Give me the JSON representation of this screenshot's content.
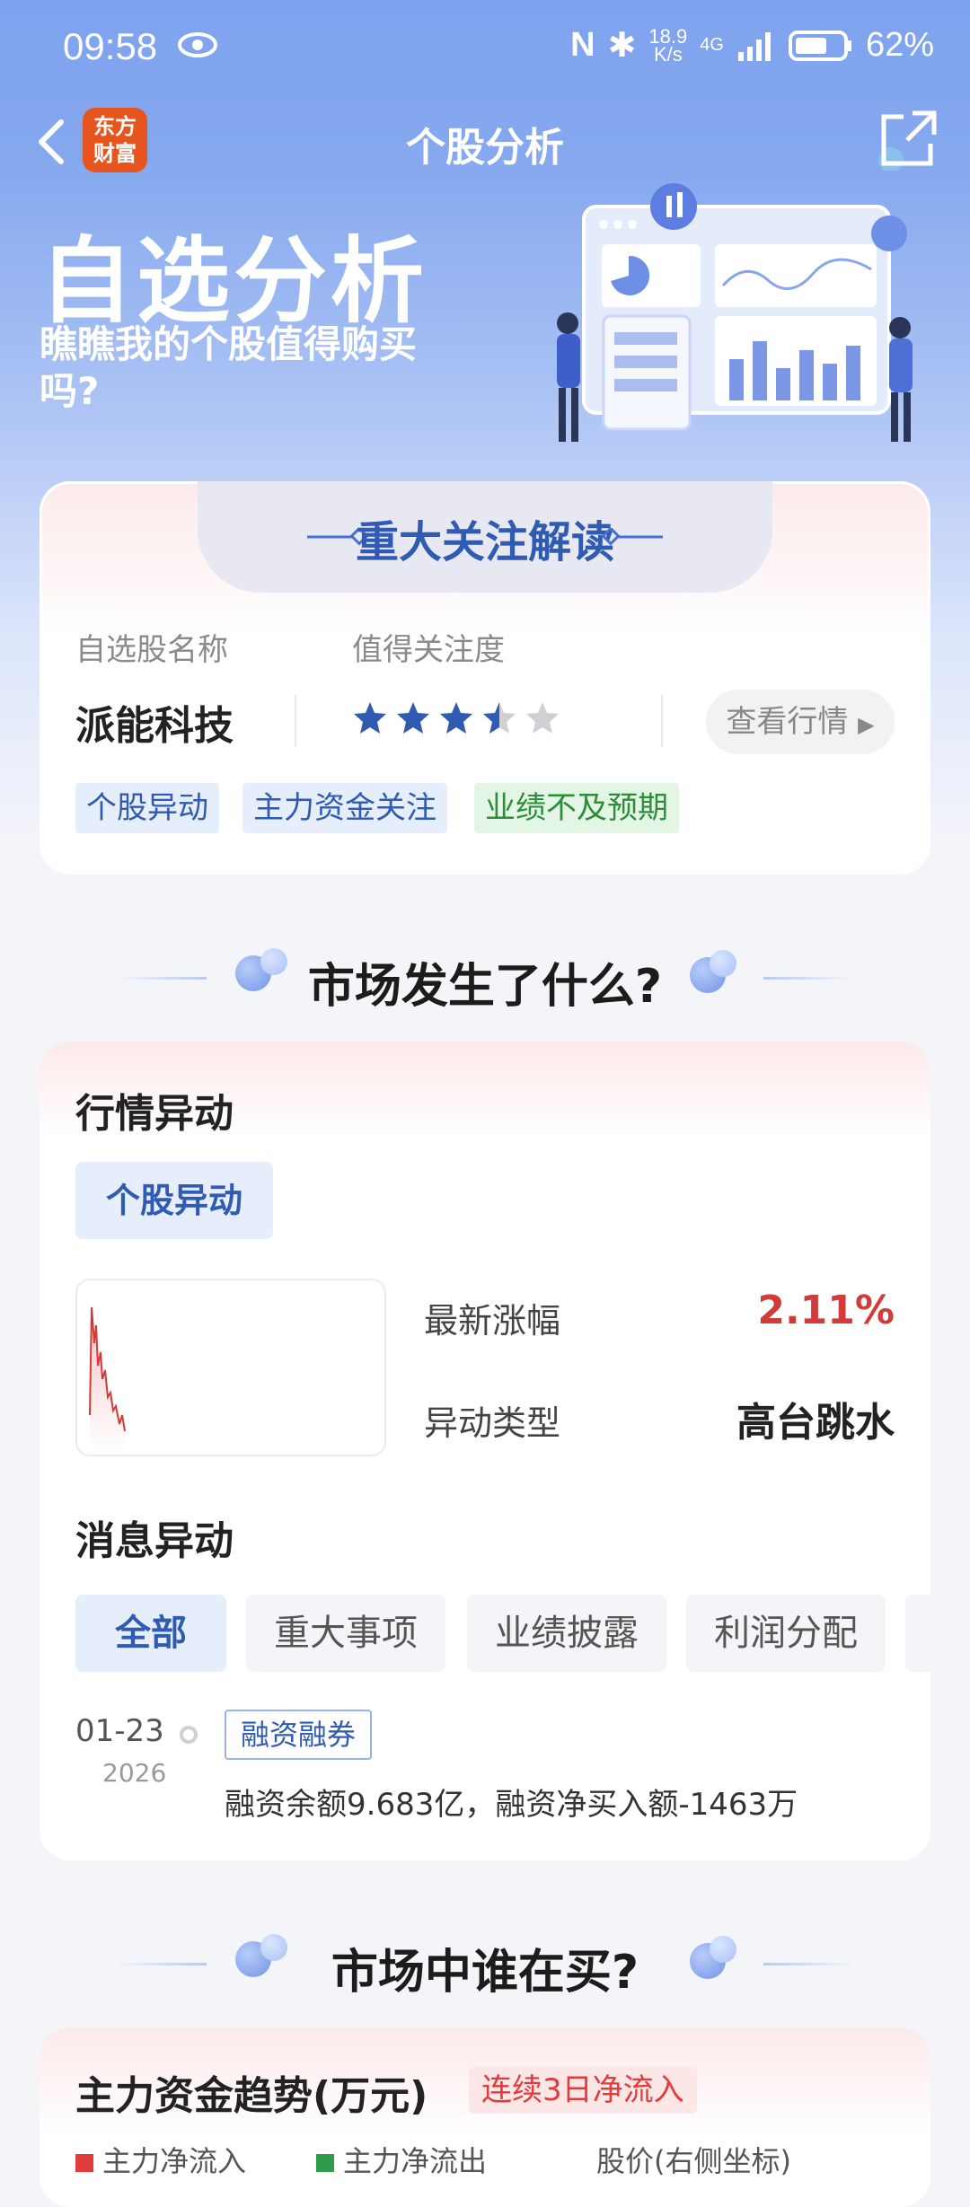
{
  "status": {
    "time": "09:58",
    "speed": "18.9\nK/s",
    "network": "4G",
    "battery": "62%"
  },
  "nav": {
    "logo": "东方\n财富",
    "title": "个股分析"
  },
  "hero": {
    "title": "自选分析",
    "subtitle": "瞧瞧我的个股值得购买吗?"
  },
  "focus_card": {
    "heading": "重大关注解读",
    "name_label": "自选股名称",
    "attention_label": "值得关注度",
    "stock_name": "派能科技",
    "rating": 3.5,
    "rating_max": 5,
    "view_button": "查看行情",
    "tags": [
      "个股异动",
      "主力资金关注",
      "业绩不及预期"
    ]
  },
  "section1": {
    "title": "市场发生了什么?"
  },
  "market_card": {
    "title": "行情异动",
    "pill": "个股异动",
    "latest_change_label": "最新涨幅",
    "latest_change_value": "2.11%",
    "type_label": "异动类型",
    "type_value": "高台跳水",
    "news_title": "消息异动",
    "filters": [
      "全部",
      "重大事项",
      "业绩披露",
      "利润分配"
    ],
    "news": {
      "date": "01-23",
      "year": "2026",
      "tag": "融资融券",
      "text": "融资余额9.683亿，融资净买入额-1463万"
    }
  },
  "section2": {
    "title": "市场中谁在买?"
  },
  "capital_card": {
    "title": "主力资金趋势(万元)",
    "badge": "连续3日净流入",
    "legend": [
      "主力净流入",
      "主力净流出",
      "股价(右侧坐标)"
    ]
  },
  "colors": {
    "brand_blue": "#2f5bb2",
    "up_red": "#d33a3a",
    "logo_orange": "#e7551f"
  }
}
